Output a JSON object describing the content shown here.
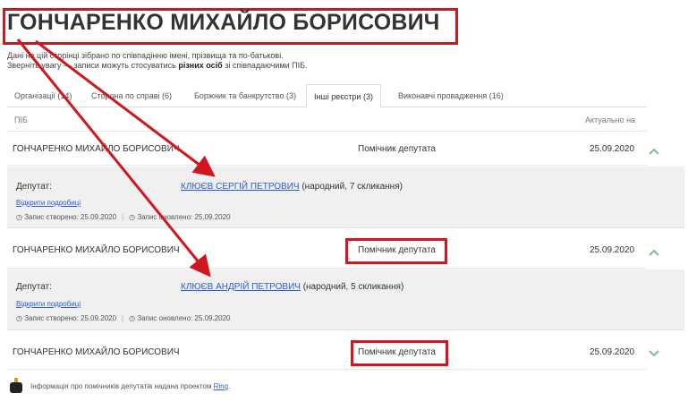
{
  "page": {
    "title": "ГОНЧАРЕНКО МИХАЙЛО БОРИСОВИЧ",
    "note_line1": "Дані на цій сторінці зібрано по співпадінню імені, прізвища та по-батькові.",
    "note_line2_pre": "Зверніть увагу — записи можуть стосуватись ",
    "note_line2_bold": "різних осіб",
    "note_line2_post": " зі співпадаючими ПІБ."
  },
  "tabs": [
    {
      "label": "Організації (14)",
      "active": false
    },
    {
      "label": "Сторона по справі (6)",
      "active": false
    },
    {
      "label": "Боржник та банкрутство (3)",
      "active": false
    },
    {
      "label": "Інші реєстри (3)",
      "active": true
    },
    {
      "label": "Виконавчі провадження (16)",
      "active": false
    }
  ],
  "table": {
    "col_name": "ПІБ",
    "col_date": "Актуально на"
  },
  "rows": [
    {
      "name": "ГОНЧАРЕНКО МИХАЙЛО БОРИСОВИЧ",
      "role": "Помічник депутата",
      "date": "25.09.2020",
      "expanded": true,
      "detail": {
        "label": "Депутат:",
        "deputy": "КЛЮЄВ СЕРГІЙ ПЕТРОВИЧ",
        "deputy_suffix": " (народний, 7 скликання)",
        "more": "Відкрити подробиці",
        "created": "Запис створено: 25.09.2020",
        "updated": "Запис оновлено: 25.09.2020"
      }
    },
    {
      "name": "ГОНЧАРЕНКО МИХАЙЛО БОРИСОВИЧ",
      "role": "Помічник депутата",
      "date": "25.09.2020",
      "expanded": true,
      "detail": {
        "label": "Депутат:",
        "deputy": "КЛЮЄВ АНДРІЙ ПЕТРОВИЧ",
        "deputy_suffix": " (народний, 5 скликання)",
        "more": "Відкрити подробиці",
        "created": "Запис створено: 25.09.2020",
        "updated": "Запис оновлено: 25.09.2020"
      }
    },
    {
      "name": "ГОНЧАРЕНКО МИХАЙЛО БОРИСОВИЧ",
      "role": "Помічник депутата",
      "date": "25.09.2020",
      "expanded": false
    }
  ],
  "footer": {
    "text_pre": "Інформація про помічників депутатів надана проектом ",
    "link": "Ring",
    "text_post": "."
  },
  "icons": {
    "chevron_up": "chevron-up-icon",
    "chevron_down": "chevron-down-icon",
    "clock": "clock-icon",
    "logo": "ring-logo-icon"
  },
  "colors": {
    "annotation_red": "#d0171d",
    "link_blue": "#2a5bd7",
    "chevron_green": "#7cbf8a",
    "detail_bg": "#f0f0f0"
  }
}
